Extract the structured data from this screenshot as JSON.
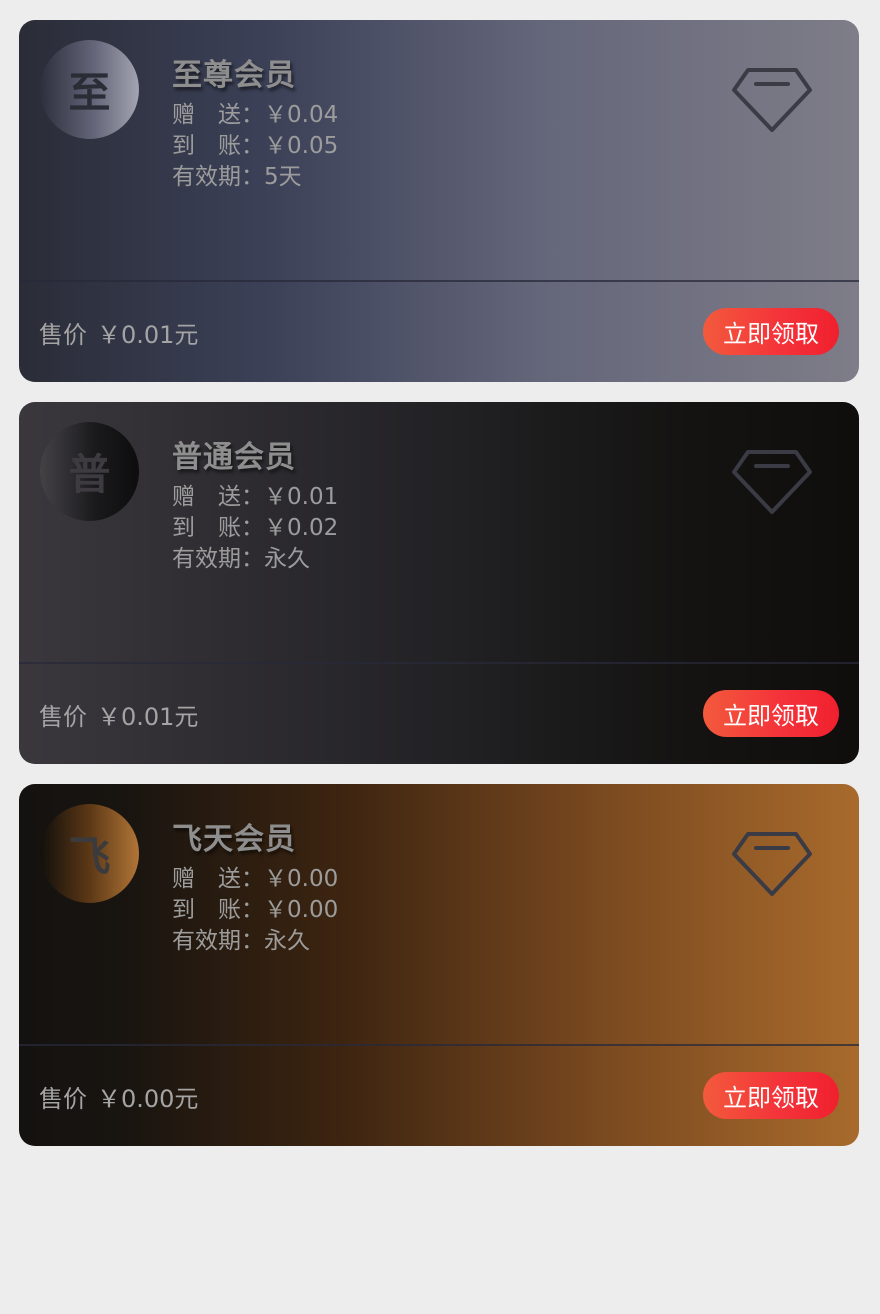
{
  "cards": [
    {
      "avatar_char": "至",
      "title": "至尊会员",
      "gift_label": "赠　送：",
      "gift_value": "￥0.04",
      "credited_label": "到　账：",
      "credited_value": "￥0.05",
      "validity_label": "有效期：",
      "validity_value": "5天",
      "price_label": "售价",
      "price_value": "￥0.01元",
      "button_label": "立即领取",
      "icon": "diamond-icon"
    },
    {
      "avatar_char": "普",
      "title": "普通会员",
      "gift_label": "赠　送：",
      "gift_value": "￥0.01",
      "credited_label": "到　账：",
      "credited_value": "￥0.02",
      "validity_label": "有效期：",
      "validity_value": "永久",
      "price_label": "售价",
      "price_value": "￥0.01元",
      "button_label": "立即领取",
      "icon": "diamond-icon"
    },
    {
      "avatar_char": "飞",
      "title": "飞天会员",
      "gift_label": "赠　送：",
      "gift_value": "￥0.00",
      "credited_label": "到　账：",
      "credited_value": "￥0.00",
      "validity_label": "有效期：",
      "validity_value": "永久",
      "price_label": "售价",
      "price_value": "￥0.00元",
      "button_label": "立即领取",
      "icon": "diamond-icon"
    }
  ],
  "colors": {
    "page_background": "#ededed",
    "button_gradient_start": "#f35a3c",
    "button_gradient_end": "#f0202e",
    "icon_stroke": "#3a3b45"
  }
}
